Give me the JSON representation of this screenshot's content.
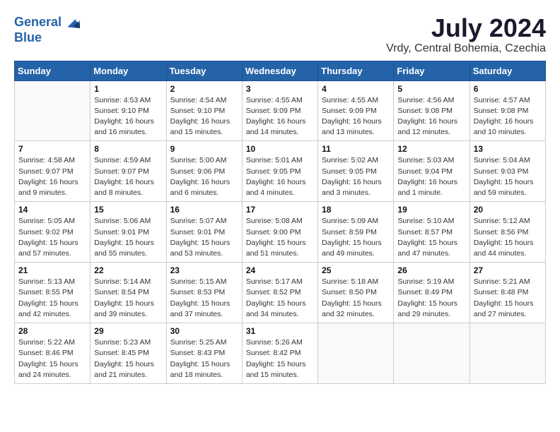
{
  "logo": {
    "line1": "General",
    "line2": "Blue"
  },
  "title": "July 2024",
  "location": "Vrdy, Central Bohemia, Czechia",
  "weekdays": [
    "Sunday",
    "Monday",
    "Tuesday",
    "Wednesday",
    "Thursday",
    "Friday",
    "Saturday"
  ],
  "weeks": [
    [
      {
        "day": "",
        "info": ""
      },
      {
        "day": "1",
        "info": "Sunrise: 4:53 AM\nSunset: 9:10 PM\nDaylight: 16 hours\nand 16 minutes."
      },
      {
        "day": "2",
        "info": "Sunrise: 4:54 AM\nSunset: 9:10 PM\nDaylight: 16 hours\nand 15 minutes."
      },
      {
        "day": "3",
        "info": "Sunrise: 4:55 AM\nSunset: 9:09 PM\nDaylight: 16 hours\nand 14 minutes."
      },
      {
        "day": "4",
        "info": "Sunrise: 4:55 AM\nSunset: 9:09 PM\nDaylight: 16 hours\nand 13 minutes."
      },
      {
        "day": "5",
        "info": "Sunrise: 4:56 AM\nSunset: 9:08 PM\nDaylight: 16 hours\nand 12 minutes."
      },
      {
        "day": "6",
        "info": "Sunrise: 4:57 AM\nSunset: 9:08 PM\nDaylight: 16 hours\nand 10 minutes."
      }
    ],
    [
      {
        "day": "7",
        "info": "Sunrise: 4:58 AM\nSunset: 9:07 PM\nDaylight: 16 hours\nand 9 minutes."
      },
      {
        "day": "8",
        "info": "Sunrise: 4:59 AM\nSunset: 9:07 PM\nDaylight: 16 hours\nand 8 minutes."
      },
      {
        "day": "9",
        "info": "Sunrise: 5:00 AM\nSunset: 9:06 PM\nDaylight: 16 hours\nand 6 minutes."
      },
      {
        "day": "10",
        "info": "Sunrise: 5:01 AM\nSunset: 9:05 PM\nDaylight: 16 hours\nand 4 minutes."
      },
      {
        "day": "11",
        "info": "Sunrise: 5:02 AM\nSunset: 9:05 PM\nDaylight: 16 hours\nand 3 minutes."
      },
      {
        "day": "12",
        "info": "Sunrise: 5:03 AM\nSunset: 9:04 PM\nDaylight: 16 hours\nand 1 minute."
      },
      {
        "day": "13",
        "info": "Sunrise: 5:04 AM\nSunset: 9:03 PM\nDaylight: 15 hours\nand 59 minutes."
      }
    ],
    [
      {
        "day": "14",
        "info": "Sunrise: 5:05 AM\nSunset: 9:02 PM\nDaylight: 15 hours\nand 57 minutes."
      },
      {
        "day": "15",
        "info": "Sunrise: 5:06 AM\nSunset: 9:01 PM\nDaylight: 15 hours\nand 55 minutes."
      },
      {
        "day": "16",
        "info": "Sunrise: 5:07 AM\nSunset: 9:01 PM\nDaylight: 15 hours\nand 53 minutes."
      },
      {
        "day": "17",
        "info": "Sunrise: 5:08 AM\nSunset: 9:00 PM\nDaylight: 15 hours\nand 51 minutes."
      },
      {
        "day": "18",
        "info": "Sunrise: 5:09 AM\nSunset: 8:59 PM\nDaylight: 15 hours\nand 49 minutes."
      },
      {
        "day": "19",
        "info": "Sunrise: 5:10 AM\nSunset: 8:57 PM\nDaylight: 15 hours\nand 47 minutes."
      },
      {
        "day": "20",
        "info": "Sunrise: 5:12 AM\nSunset: 8:56 PM\nDaylight: 15 hours\nand 44 minutes."
      }
    ],
    [
      {
        "day": "21",
        "info": "Sunrise: 5:13 AM\nSunset: 8:55 PM\nDaylight: 15 hours\nand 42 minutes."
      },
      {
        "day": "22",
        "info": "Sunrise: 5:14 AM\nSunset: 8:54 PM\nDaylight: 15 hours\nand 39 minutes."
      },
      {
        "day": "23",
        "info": "Sunrise: 5:15 AM\nSunset: 8:53 PM\nDaylight: 15 hours\nand 37 minutes."
      },
      {
        "day": "24",
        "info": "Sunrise: 5:17 AM\nSunset: 8:52 PM\nDaylight: 15 hours\nand 34 minutes."
      },
      {
        "day": "25",
        "info": "Sunrise: 5:18 AM\nSunset: 8:50 PM\nDaylight: 15 hours\nand 32 minutes."
      },
      {
        "day": "26",
        "info": "Sunrise: 5:19 AM\nSunset: 8:49 PM\nDaylight: 15 hours\nand 29 minutes."
      },
      {
        "day": "27",
        "info": "Sunrise: 5:21 AM\nSunset: 8:48 PM\nDaylight: 15 hours\nand 27 minutes."
      }
    ],
    [
      {
        "day": "28",
        "info": "Sunrise: 5:22 AM\nSunset: 8:46 PM\nDaylight: 15 hours\nand 24 minutes."
      },
      {
        "day": "29",
        "info": "Sunrise: 5:23 AM\nSunset: 8:45 PM\nDaylight: 15 hours\nand 21 minutes."
      },
      {
        "day": "30",
        "info": "Sunrise: 5:25 AM\nSunset: 8:43 PM\nDaylight: 15 hours\nand 18 minutes."
      },
      {
        "day": "31",
        "info": "Sunrise: 5:26 AM\nSunset: 8:42 PM\nDaylight: 15 hours\nand 15 minutes."
      },
      {
        "day": "",
        "info": ""
      },
      {
        "day": "",
        "info": ""
      },
      {
        "day": "",
        "info": ""
      }
    ]
  ]
}
